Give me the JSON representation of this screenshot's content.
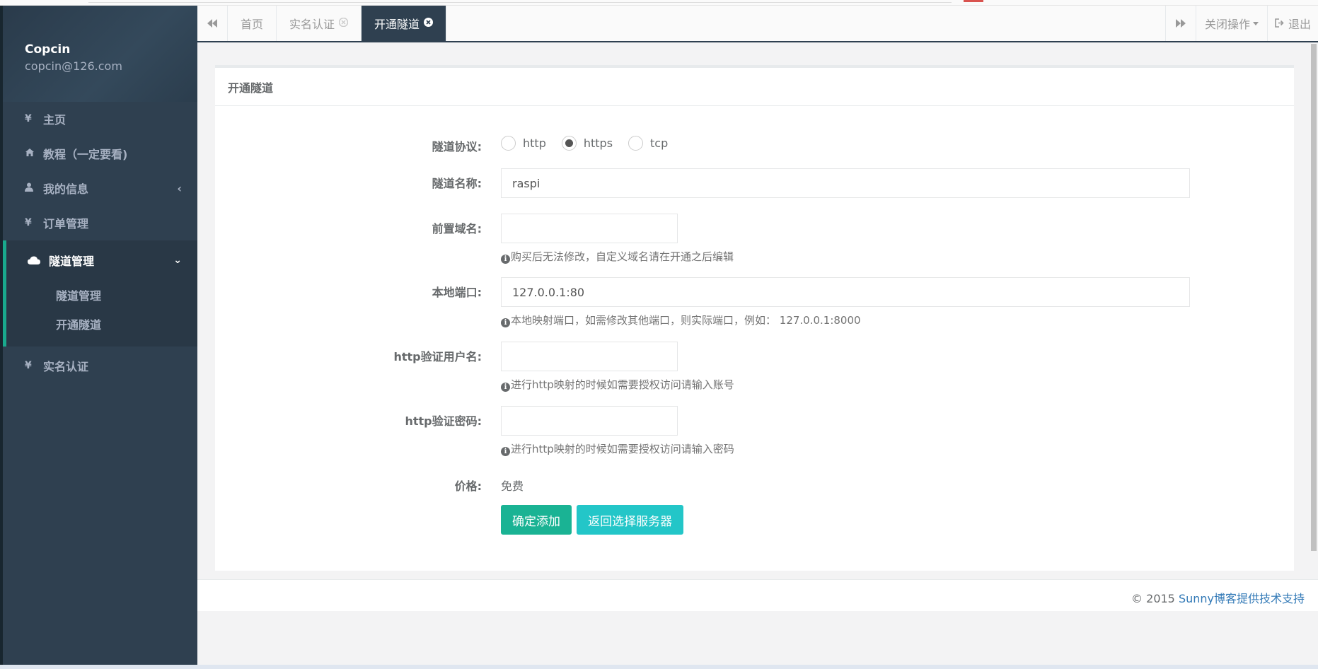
{
  "sidebar": {
    "user_name": "Copcin",
    "user_email": "copcin@126.com",
    "items": [
      {
        "icon": "yen-icon",
        "label": "主页"
      },
      {
        "icon": "home-icon",
        "label": "教程（一定要看)"
      },
      {
        "icon": "user-icon",
        "label": "我的信息"
      },
      {
        "icon": "yen-icon",
        "label": "订单管理"
      },
      {
        "icon": "cloud-icon",
        "label": "隧道管理"
      },
      {
        "icon": "yen-icon",
        "label": "实名认证"
      }
    ],
    "sub_items": [
      {
        "label": "隧道管理"
      },
      {
        "label": "开通隧道"
      }
    ]
  },
  "tabbar": {
    "tabs": [
      {
        "label": "首页"
      },
      {
        "label": "实名认证"
      },
      {
        "label": "开通隧道"
      }
    ],
    "close_ops": "关闭操作",
    "logout": "退出"
  },
  "form": {
    "title": "开通隧道",
    "protocol_label": "隧道协议:",
    "protocols": [
      "http",
      "https",
      "tcp"
    ],
    "selected_protocol": "https",
    "name_label": "隧道名称:",
    "name_value": "raspi",
    "domain_label": "前置域名:",
    "domain_value": "",
    "domain_help": "购买后无法修改，自定义域名请在开通之后编辑",
    "port_label": "本地端口:",
    "port_value": "127.0.0.1:80",
    "port_help": "本地映射端口，如需修改其他端口，则实际端口，例如： 127.0.0.1:8000",
    "user_label": "http验证用户名:",
    "user_value": "",
    "user_help": "进行http映射的时候如需要授权访问请输入账号",
    "pass_label": "http验证密码:",
    "pass_value": "",
    "pass_help": "进行http映射的时候如需要授权访问请输入密码",
    "price_label": "价格:",
    "price_value": "免费",
    "submit_label": "确定添加",
    "back_label": "返回选择服务器"
  },
  "footer": {
    "copyright": "© 2015 ",
    "link": "Sunny博客提供技术支持"
  },
  "colors": {
    "sidebar_bg": "#2f4050",
    "accent": "#19aa8d",
    "primary_button": "#1ab394",
    "info_button": "#23c6c8",
    "link": "#337ab7"
  }
}
